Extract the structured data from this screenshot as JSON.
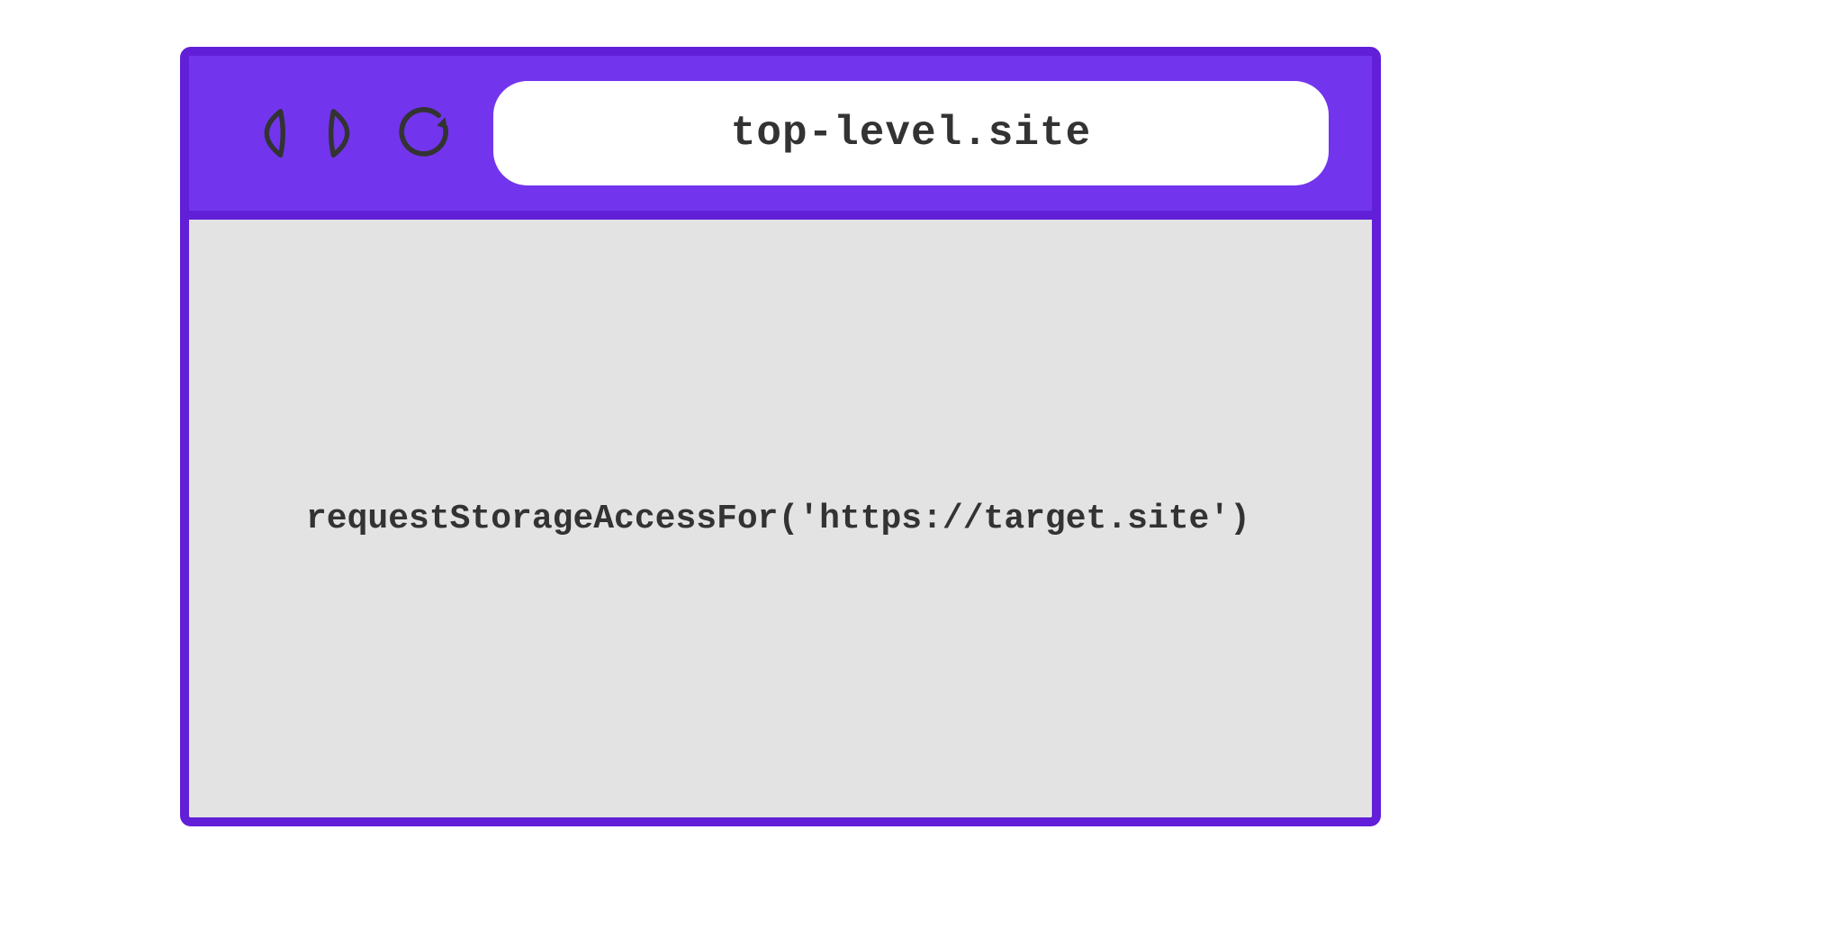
{
  "browser": {
    "address": "top-level.site",
    "content_code": "requestStorageAccessFor('https://target.site')"
  },
  "colors": {
    "toolbar": "#7235ed",
    "border": "#6120d7",
    "page": "#e3e3e3",
    "text": "#333333",
    "address_bg": "#ffffff"
  }
}
